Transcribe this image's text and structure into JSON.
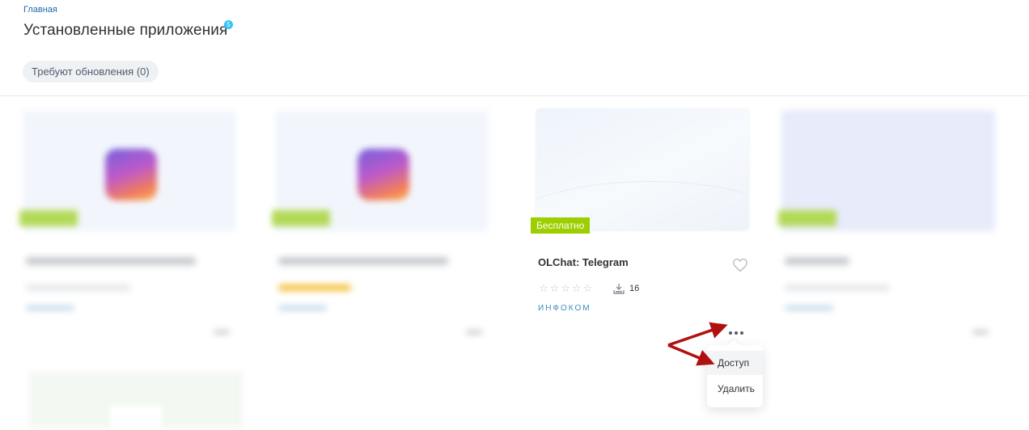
{
  "header": {
    "breadcrumb": "Главная",
    "title": "Установленные приложения",
    "title_badge": "5",
    "filter_button": "Требуют обновления (0)"
  },
  "focused_app": {
    "price_badge": "Бесплатно",
    "name": "OLChat: Telegram",
    "rating_stars": 0,
    "max_stars": 5,
    "installs": "16",
    "vendor": "ИНФОКОМ"
  },
  "context_menu": {
    "items": [
      "Доступ",
      "Удалить"
    ],
    "highlighted": "Доступ"
  },
  "colors": {
    "accent_blue": "#2067b0",
    "badge_blue": "#2fc6f6",
    "price_green": "#9dcf00",
    "vendor_blue": "#3b8dbc",
    "annotation_red": "#b01010"
  }
}
